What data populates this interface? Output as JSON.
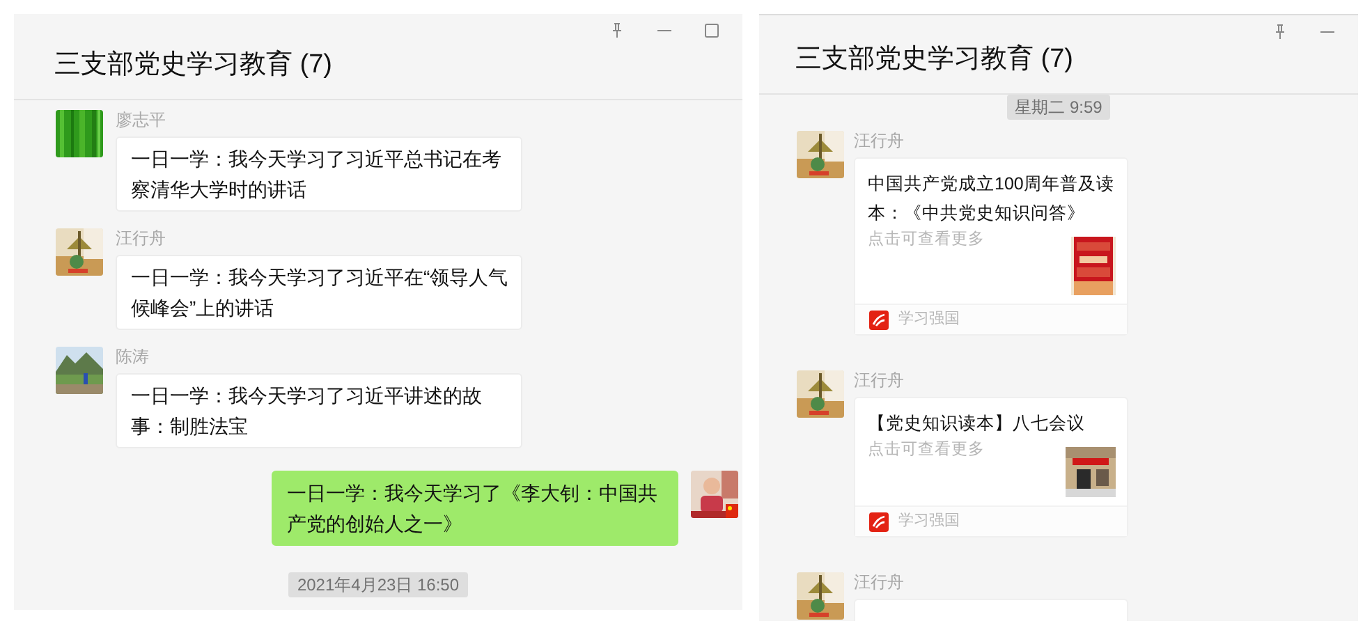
{
  "windows": [
    {
      "title": "三支部党史学习教育 (7)",
      "window_buttons": [
        {
          "kind": "pin"
        },
        {
          "kind": "minimize"
        },
        {
          "kind": "maximize"
        }
      ],
      "messages": [
        {
          "kind": "text",
          "sender": "廖志平",
          "outgoing": false,
          "text": "一日一学：我今天学习了习近平总书记在考察清华大学时的讲话"
        },
        {
          "kind": "text",
          "sender": "汪行舟",
          "outgoing": false,
          "text": "一日一学：我今天学习了习近平在“领导人气候峰会”上的讲话"
        },
        {
          "kind": "text",
          "sender": "陈涛",
          "outgoing": false,
          "text": "一日一学：我今天学习了习近平讲述的故事：制胜法宝"
        },
        {
          "kind": "text",
          "outgoing": true,
          "text": "一日一学：我今天学习了《李大钊：中国共产党的创始人之一》"
        },
        {
          "kind": "time",
          "text": "2021年4月23日 16:50"
        }
      ]
    },
    {
      "title": "三支部党史学习教育 (7)",
      "window_buttons": [
        {
          "kind": "pin"
        },
        {
          "kind": "minimize"
        }
      ],
      "messages": [
        {
          "kind": "time",
          "text": "星期二 9:59"
        },
        {
          "kind": "card",
          "sender": "汪行舟",
          "outgoing": false,
          "title": "中国共产党成立100周年普及读本：《中共党史知识问答》",
          "description": "点击可查看更多",
          "source": "学习强国"
        },
        {
          "kind": "card",
          "sender": "汪行舟",
          "outgoing": false,
          "title": "【党史知识读本】八七会议",
          "description": "点击可查看更多",
          "source": "学习强国"
        },
        {
          "kind": "card",
          "sender": "汪行舟",
          "outgoing": false
        }
      ]
    }
  ]
}
